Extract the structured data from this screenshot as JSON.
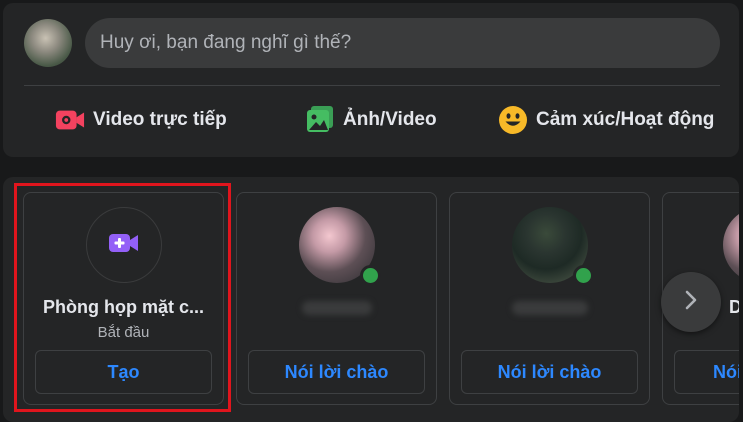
{
  "composer": {
    "placeholder": "Huy ơi, bạn đang nghĩ gì thế?",
    "actions": [
      {
        "label": "Video trực tiếp",
        "icon": "live-video-icon",
        "color": "#f3425f"
      },
      {
        "label": "Ảnh/Video",
        "icon": "photo-icon",
        "color": "#45bd62"
      },
      {
        "label": "Cảm xúc/Hoạt động",
        "icon": "smiley-icon",
        "color": "#f7b928"
      }
    ]
  },
  "rooms": {
    "create": {
      "title": "Phòng họp mặt c...",
      "subtitle": "Bắt đầu",
      "button": "Tạo",
      "icon": "video-plus-icon",
      "icon_color": "#9360f7"
    },
    "friends": [
      {
        "button": "Nói lời chào",
        "online": true
      },
      {
        "button": "Nói lời chào",
        "online": true
      },
      {
        "button": "Nói",
        "online": false
      }
    ],
    "partial_title_letter": "D"
  },
  "colors": {
    "accent": "#2d88ff",
    "highlight": "#e0151d",
    "online": "#31a24c"
  }
}
